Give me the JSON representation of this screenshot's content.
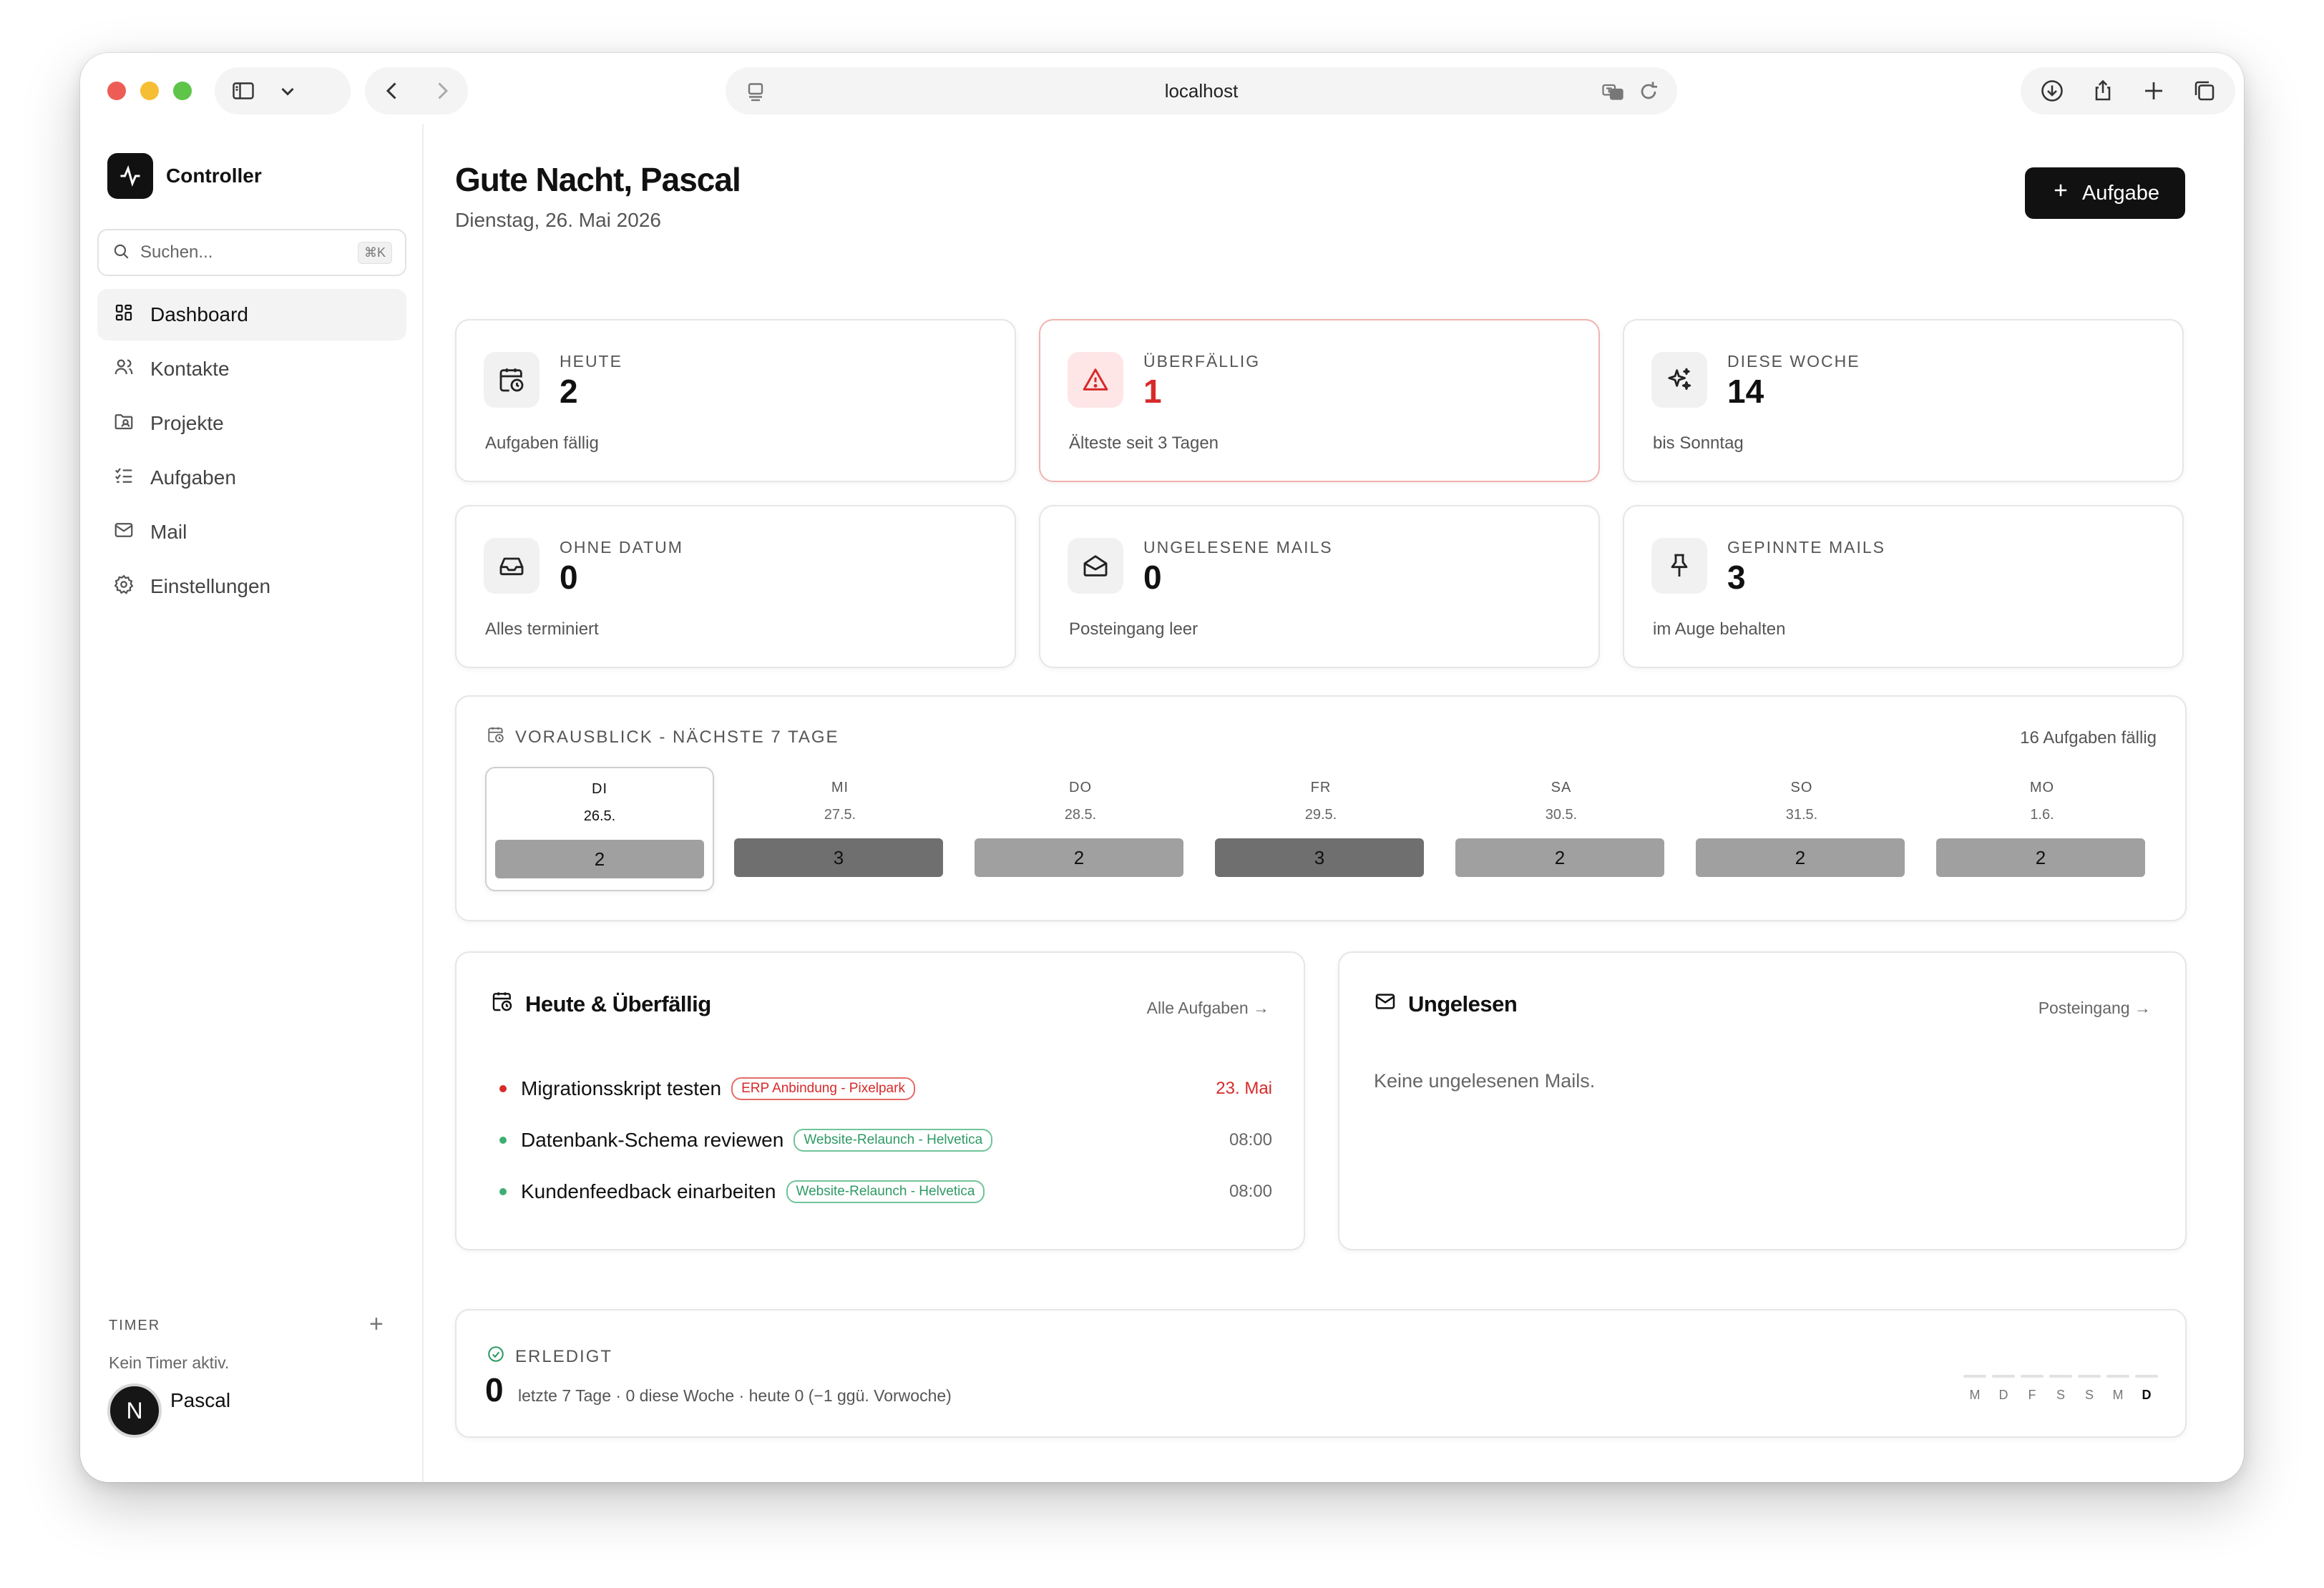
{
  "browser": {
    "url": "localhost"
  },
  "sidebar": {
    "brand": "Controller",
    "search_placeholder": "Suchen...",
    "search_shortcut": "⌘K",
    "items": [
      {
        "label": "Dashboard",
        "icon": "dashboard-icon",
        "active": true
      },
      {
        "label": "Kontakte",
        "icon": "contacts-icon"
      },
      {
        "label": "Projekte",
        "icon": "projects-icon"
      },
      {
        "label": "Aufgaben",
        "icon": "tasks-icon"
      },
      {
        "label": "Mail",
        "icon": "mail-icon"
      },
      {
        "label": "Einstellungen",
        "icon": "settings-icon"
      }
    ],
    "timer": {
      "label": "TIMER",
      "empty": "Kein Timer aktiv."
    },
    "user": {
      "initial": "N",
      "name": "Pascal"
    }
  },
  "header": {
    "greeting": "Gute Nacht, Pascal",
    "date": "Dienstag, 26. Mai 2026",
    "add_button": "Aufgabe"
  },
  "stats": [
    {
      "label": "HEUTE",
      "value": "2",
      "sub": "Aufgaben fällig",
      "icon": "calendar-clock-icon"
    },
    {
      "label": "ÜBERFÄLLIG",
      "value": "1",
      "sub": "Älteste seit 3 Tagen",
      "icon": "warning-icon",
      "alert": true
    },
    {
      "label": "DIESE WOCHE",
      "value": "14",
      "sub": "bis Sonntag",
      "icon": "sparkles-icon"
    },
    {
      "label": "OHNE DATUM",
      "value": "0",
      "sub": "Alles terminiert",
      "icon": "inbox-icon"
    },
    {
      "label": "UNGELESENE MAILS",
      "value": "0",
      "sub": "Posteingang leer",
      "icon": "mail-open-icon"
    },
    {
      "label": "GEPINNTE MAILS",
      "value": "3",
      "sub": "im Auge behalten",
      "icon": "pin-icon"
    }
  ],
  "outlook": {
    "title": "VORAUSBLICK - NÄCHSTE 7 TAGE",
    "count": "16 Aufgaben fällig",
    "days": [
      {
        "name": "DI",
        "date": "26.5.",
        "count": "2",
        "today": true
      },
      {
        "name": "MI",
        "date": "27.5.",
        "count": "3"
      },
      {
        "name": "DO",
        "date": "28.5.",
        "count": "2"
      },
      {
        "name": "FR",
        "date": "29.5.",
        "count": "3"
      },
      {
        "name": "SA",
        "date": "30.5.",
        "count": "2"
      },
      {
        "name": "SO",
        "date": "31.5.",
        "count": "2"
      },
      {
        "name": "MO",
        "date": "1.6.",
        "count": "2"
      }
    ]
  },
  "tasks_panel": {
    "title": "Heute & Überfällig",
    "link": "Alle Aufgaben →",
    "tasks": [
      {
        "name": "Migrationsskript testen",
        "project": "ERP Anbindung - Pixelpark",
        "when": "23. Mai",
        "overdue": true
      },
      {
        "name": "Datenbank-Schema reviewen",
        "project": "Website-Relaunch - Helvetica",
        "when": "08:00"
      },
      {
        "name": "Kundenfeedback einarbeiten",
        "project": "Website-Relaunch - Helvetica",
        "when": "08:00"
      }
    ]
  },
  "mails_panel": {
    "title": "Ungelesen",
    "link": "Posteingang →",
    "empty": "Keine ungelesenen Mails."
  },
  "done": {
    "title": "ERLEDIGT",
    "value": "0",
    "sub": "letzte 7 Tage · 0 diese Woche · heute 0   (−1 ggü. Vorwoche)",
    "days": [
      "M",
      "D",
      "F",
      "S",
      "S",
      "M",
      "D"
    ]
  },
  "colors": {
    "accent": "#111111",
    "danger": "#d72a2a",
    "success": "#2e9a64"
  }
}
